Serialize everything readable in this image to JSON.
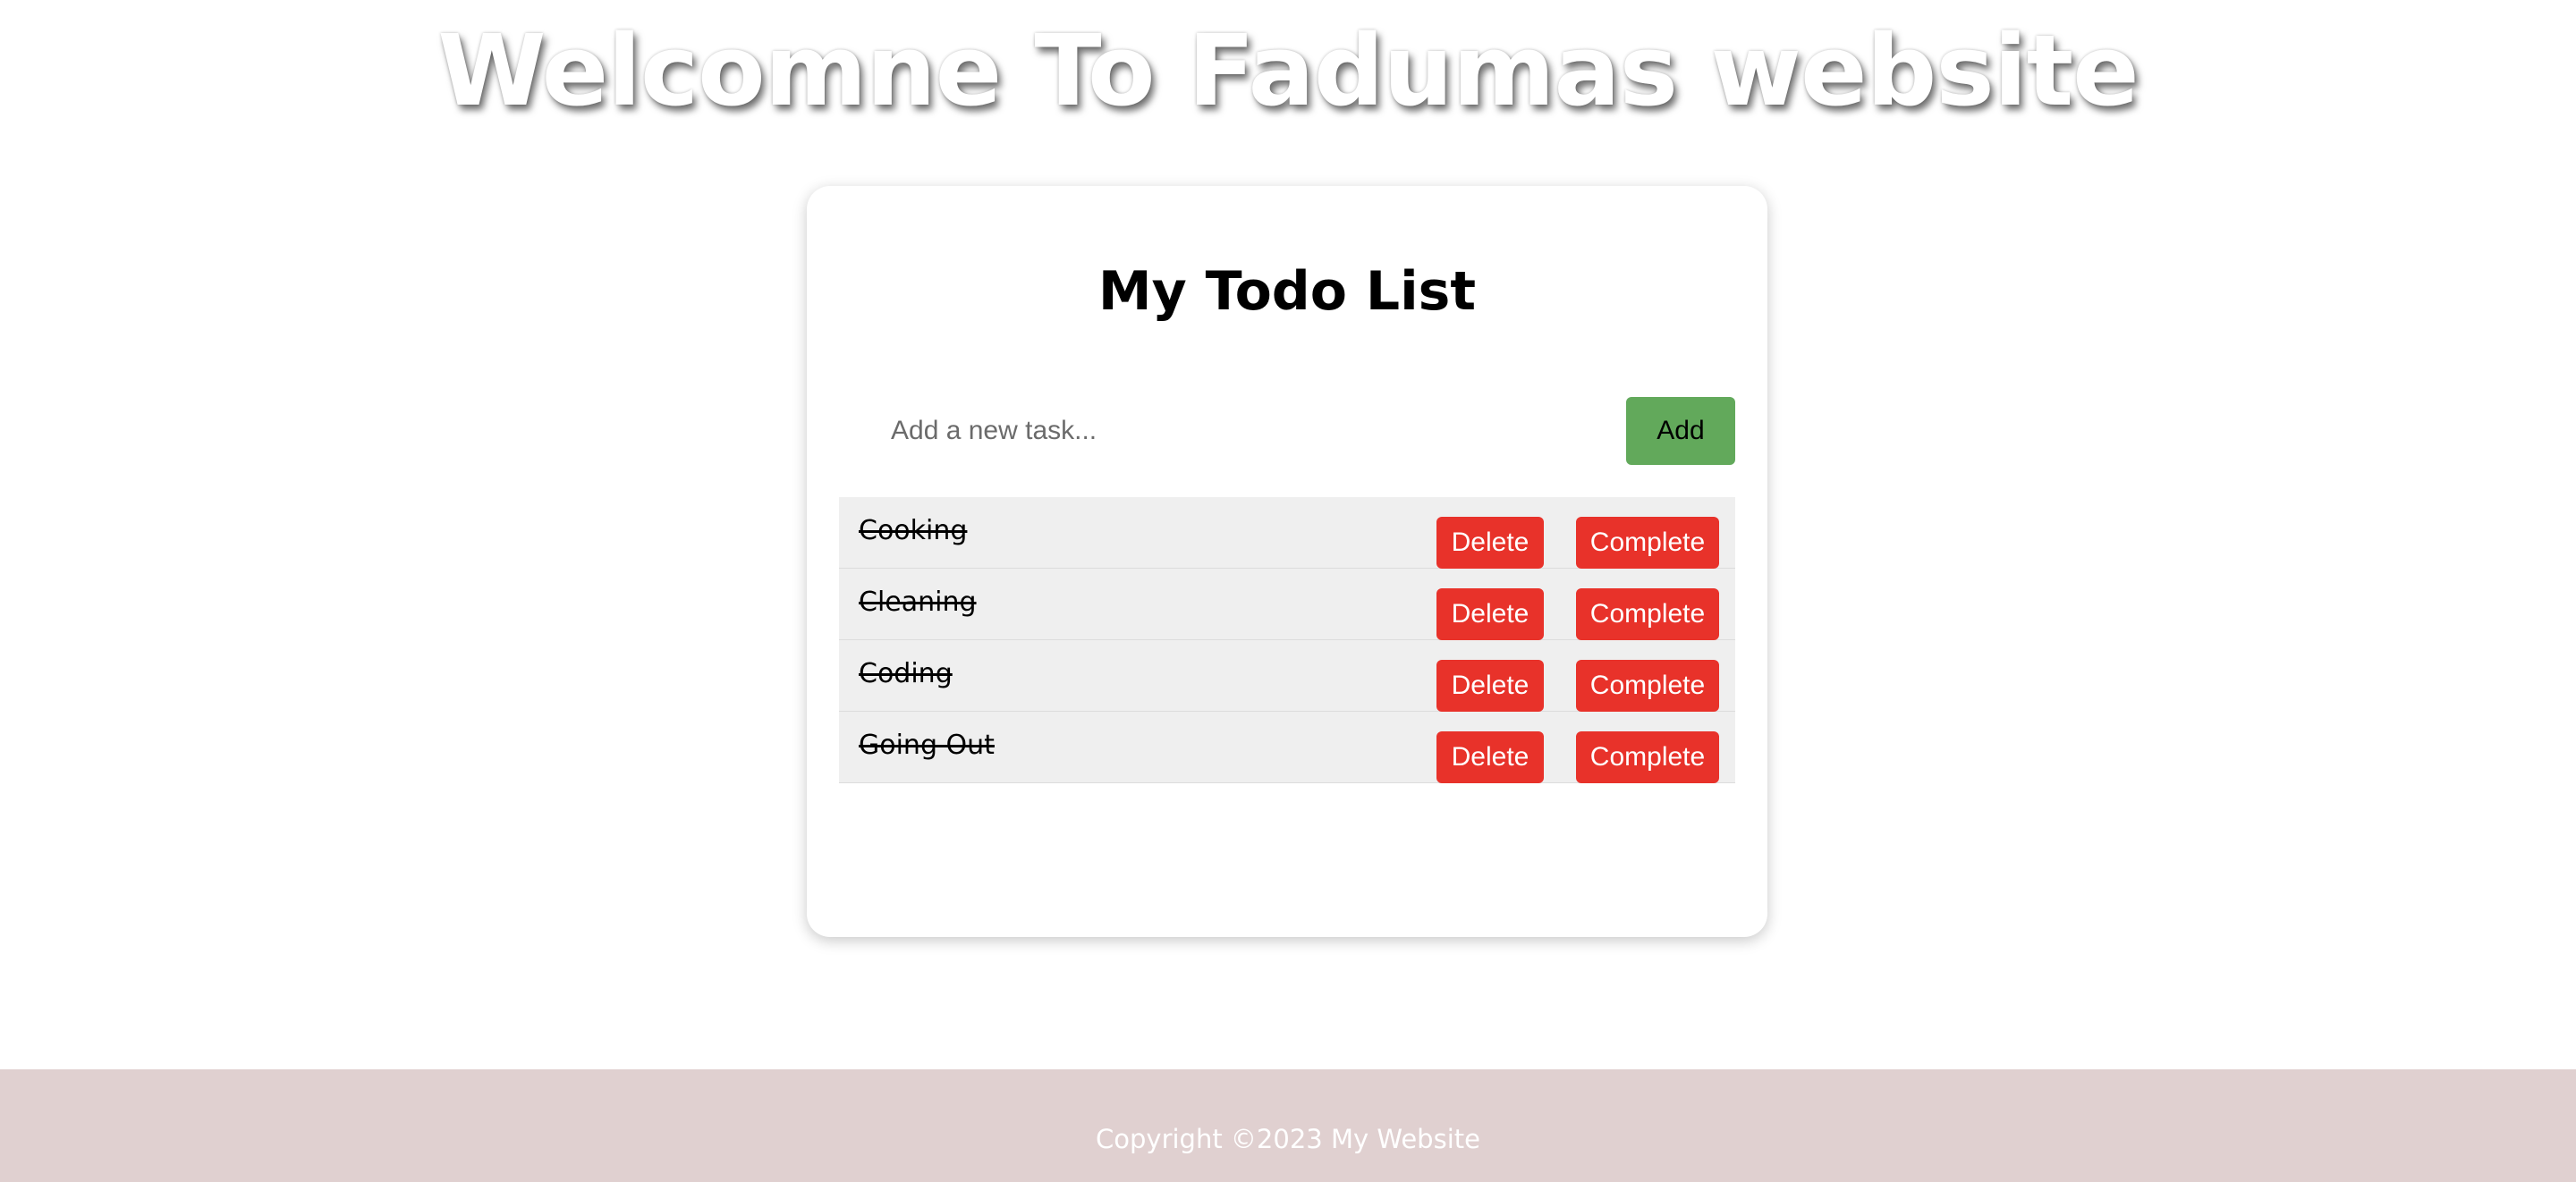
{
  "site": {
    "heading": "Welcomne To Fadumas website"
  },
  "todo": {
    "title": "My Todo List",
    "input_placeholder": "Add a new task...",
    "input_value": "",
    "add_label": "Add",
    "tasks": [
      {
        "text": "Cooking",
        "completed": true,
        "delete_label": "Delete",
        "complete_label": "Complete"
      },
      {
        "text": "Cleaning",
        "completed": true,
        "delete_label": "Delete",
        "complete_label": "Complete"
      },
      {
        "text": "Coding",
        "completed": true,
        "delete_label": "Delete",
        "complete_label": "Complete"
      },
      {
        "text": "Going Out",
        "completed": true,
        "delete_label": "Delete",
        "complete_label": "Complete"
      }
    ]
  },
  "footer": {
    "text": "Copyright ©2023 My Website"
  },
  "colors": {
    "add_button": "#62a95b",
    "action_button": "#e8322a",
    "task_background": "#efefef",
    "footer_background": "#e0d0d0"
  }
}
